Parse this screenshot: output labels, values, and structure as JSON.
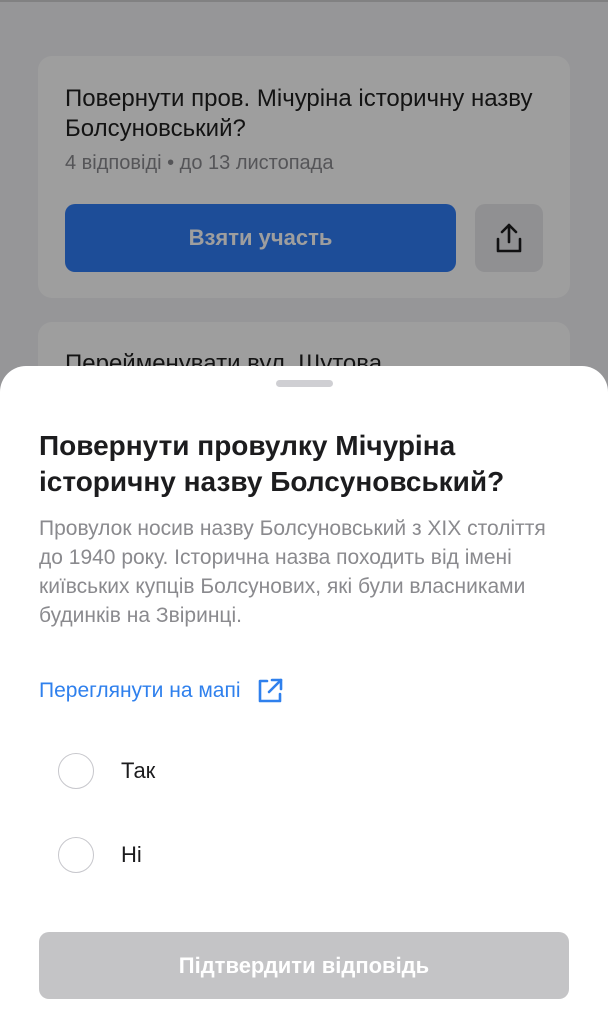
{
  "background": {
    "card1": {
      "title": "Повернути пров. Мічуріна історичну назву Болсуновський?",
      "meta": "4 відповіді • до 13 листопада",
      "participate_label": "Взяти участь",
      "share_icon": "share-icon"
    },
    "card2": {
      "title": "Перейменувати вул. Шутова"
    }
  },
  "sheet": {
    "title": "Повернути провулку Мічуріна історичну назву Болсуновський?",
    "description": "Провулок носив назву Болсуновський з XIX століття до 1940 року. Історична назва походить від імені київських купців Болсунових, які були власниками будинків на Звіринці.",
    "map_link_label": "Переглянути на мапі",
    "map_link_icon": "external-link-icon",
    "options": [
      {
        "label": "Так",
        "selected": false
      },
      {
        "label": "Ні",
        "selected": false
      }
    ],
    "confirm_label": "Підтвердити відповідь",
    "confirm_enabled": false
  },
  "colors": {
    "accent": "#2f80ed",
    "button_primary": "#2f7cf6",
    "button_disabled": "#c4c4c6",
    "overlay": "rgba(0,0,0,0.38)"
  }
}
